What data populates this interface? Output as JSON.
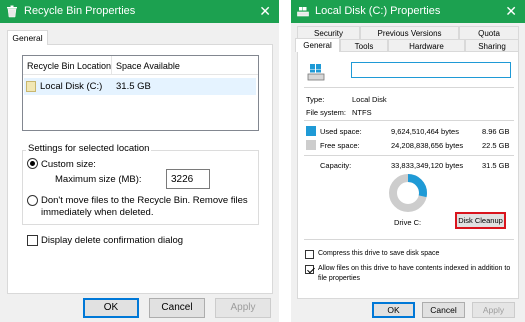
{
  "left_window": {
    "title": "Recycle Bin Properties",
    "close_glyph": "✕",
    "tab": "General",
    "list": {
      "columns": [
        "Recycle Bin Location",
        "Space Available"
      ],
      "rows": [
        {
          "location": "Local Disk (C:)",
          "space": "31.5 GB"
        }
      ]
    },
    "settings_group": "Settings for selected location",
    "custom_size_label": "Custom size:",
    "max_size_label": "Maximum size (MB):",
    "max_size_value": "3226",
    "dont_move_line1": "Don't move files to the Recycle Bin. Remove files",
    "dont_move_line2": "immediately when deleted.",
    "confirm_label": "Display delete confirmation dialog",
    "buttons": {
      "ok": "OK",
      "cancel": "Cancel",
      "apply": "Apply"
    }
  },
  "right_window": {
    "title": "Local Disk (C:) Properties",
    "close_glyph": "✕",
    "tabs_top": [
      "Security",
      "Previous Versions",
      "Quota"
    ],
    "tabs_bottom": [
      "General",
      "Tools",
      "Hardware",
      "Sharing"
    ],
    "name_value": "",
    "type_label": "Type:",
    "type_value": "Local Disk",
    "fs_label": "File system:",
    "fs_value": "NTFS",
    "used_label": "Used space:",
    "used_bytes": "9,624,510,464 bytes",
    "used_gb": "8.96 GB",
    "free_label": "Free space:",
    "free_bytes": "24,208,838,656 bytes",
    "free_gb": "22.5 GB",
    "capacity_label": "Capacity:",
    "capacity_bytes": "33,833,349,120 bytes",
    "capacity_gb": "31.5 GB",
    "used_fraction": 0.285,
    "drive_label": "Drive C:",
    "cleanup_button": "Disk Cleanup",
    "compress_label": "Compress this drive to save disk space",
    "index_line1": "Allow files on this drive to have contents indexed in addition to",
    "index_line2": "file properties",
    "buttons": {
      "ok": "OK",
      "cancel": "Cancel",
      "apply": "Apply"
    },
    "colors": {
      "used": "#1f9ad6",
      "free": "#cdcdcd",
      "cleanup_highlight": "#d9141d"
    }
  },
  "colors": {
    "titlebar": "#1ca150"
  }
}
